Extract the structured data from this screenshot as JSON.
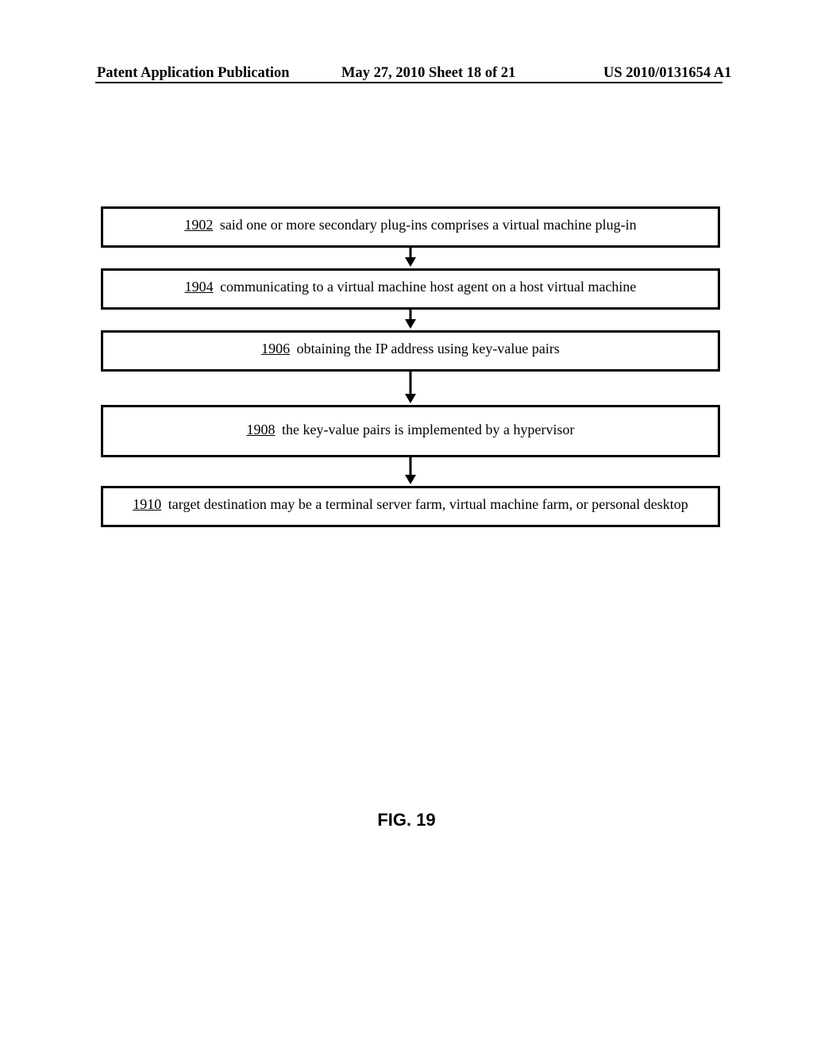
{
  "header": {
    "left": "Patent Application Publication",
    "mid": "May 27, 2010  Sheet 18 of 21",
    "right": "US 2010/0131654 A1"
  },
  "flow": {
    "steps": [
      {
        "ref": "1902",
        "text": " said one or more secondary plug-ins comprises a virtual machine plug-in"
      },
      {
        "ref": "1904",
        "text": " communicating to a virtual machine host agent on a host virtual machine"
      },
      {
        "ref": "1906",
        "text": " obtaining the IP address using key-value pairs"
      },
      {
        "ref": "1908",
        "text": " the key-value pairs is implemented by a hypervisor"
      },
      {
        "ref": "1910",
        "text": " target destination may be a terminal server farm, virtual machine farm, or personal desktop"
      }
    ]
  },
  "figure_label": "FIG. 19"
}
